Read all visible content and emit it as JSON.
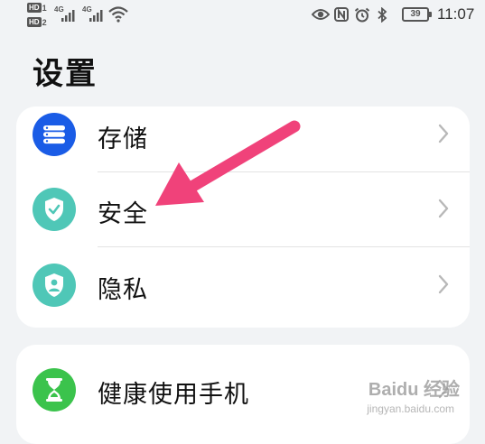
{
  "status_bar": {
    "sim1": {
      "label": "HD",
      "index": "1"
    },
    "sim2": {
      "label": "HD",
      "index": "2"
    },
    "network_type_1": "4G",
    "network_type_2": "4G",
    "battery": "39",
    "time": "11:07",
    "icons": [
      "eye-icon",
      "nfc-icon",
      "alarm-icon",
      "bluetooth-icon",
      "wifi-icon",
      "signal-icon",
      "battery-icon"
    ]
  },
  "page": {
    "title": "设置"
  },
  "settings": {
    "group1": [
      {
        "label": "存储",
        "icon": "storage-icon",
        "color": "#1a5ce6"
      },
      {
        "label": "安全",
        "icon": "security-shield-icon",
        "color": "#4fc7b7"
      },
      {
        "label": "隐私",
        "icon": "privacy-shield-icon",
        "color": "#4fc7b7"
      }
    ],
    "group2": [
      {
        "label": "健康使用手机",
        "icon": "hourglass-icon",
        "color": "#3bc34c"
      }
    ]
  },
  "annotation": {
    "arrow_color": "#f0427a"
  },
  "watermark": {
    "text": "Baidu 经验",
    "sub": "jingyan.baidu.com"
  }
}
